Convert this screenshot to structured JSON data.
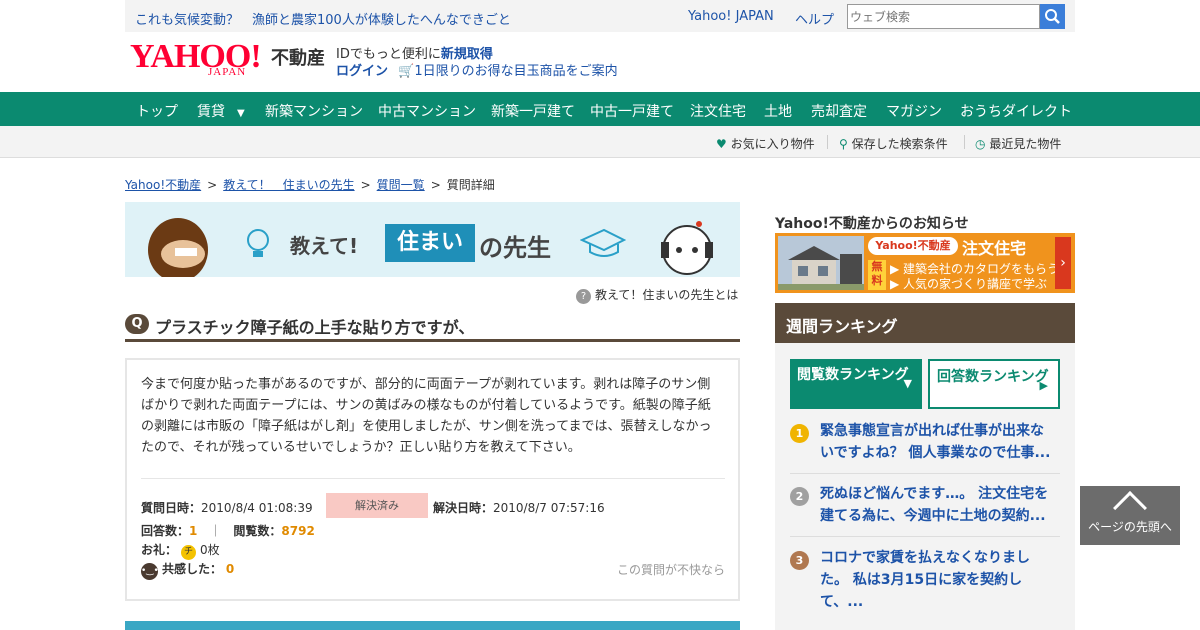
{
  "topbar": {
    "link1": "これも気候変動？",
    "link2": "漁師と農家100人が体験したへんなできごと",
    "yahoo_japan": "Yahoo! JAPAN",
    "help": "ヘルプ",
    "search_placeholder": "ウェブ検索"
  },
  "header": {
    "logo_text": "YAHOO!",
    "logo_sub": "JAPAN",
    "service": "不動産",
    "id_line": "IDでもっと便利に",
    "id_link": "新規取得",
    "login": "ログイン",
    "promo": "1日限りのお得な目玉商品をご案内"
  },
  "gnav": [
    "トップ",
    "賃貸",
    "新築マンション",
    "中古マンション",
    "新築一戸建て",
    "中古一戸建て",
    "注文住宅",
    "土地",
    "売却査定",
    "マガジン",
    "おうちダイレクト"
  ],
  "subnav": {
    "fav": "お気に入り物件",
    "saved": "保存した検索条件",
    "recent": "最近見た物件"
  },
  "breadcrumb": [
    "Yahoo!不動産",
    "教えて！　住まいの先生",
    "質問一覧",
    "質問詳細"
  ],
  "banner": {
    "t1": "教えて!",
    "house": "住まい",
    "t2": "の先生"
  },
  "about": "教えて！住まいの先生とは",
  "question": {
    "badge": "Q",
    "title": "プラスチック障子紙の上手な貼り方ですが、",
    "body": "今まで何度か貼った事があるのですが、部分的に両面テープが剥れています。剥れは障子のサン側ばかりで剥れた両面テープには、サンの黄ばみの様なものが付着しているようです。紙製の障子紙の剥離には市販の「障子紙はがし剤」を使用しましたが、サン側を洗ってまでは、張替えしなかったので、それが残っているせいでしょうか？正しい貼り方を教えて下さい。",
    "asked_label": "質問日時：",
    "asked": "2010/8/4 01:08:39",
    "status": "解決済み",
    "solved_label": "解決日時：",
    "solved": "2010/8/7 07:57:16",
    "answers_label": "回答数：",
    "answers": "1",
    "views_label": "閲覧数：",
    "views": "8792",
    "reward_label": "お礼：",
    "reward_chip": "チ",
    "reward": "0枚",
    "empathy_label": "共感した：",
    "empathy": "0",
    "report": "この質問が不快なら"
  },
  "sidebar": {
    "news_title": "Yahoo!不動産からのお知らせ",
    "news_pill": "Yahoo!不動産",
    "news_head": "注文住宅",
    "news_free": "無料",
    "news_l1": "建築会社のカタログをもらう",
    "news_l2": "人気の家づくり講座で学ぶ",
    "ranking_title": "週間ランキング",
    "tab1": "閲覧数ランキング",
    "tab2": "回答数ランキング",
    "ranks": [
      {
        "num": "1",
        "color": "#f0b400",
        "text": "緊急事態宣言が出れば仕事が出来ないですよね？ 個人事業なので仕事..."
      },
      {
        "num": "2",
        "color": "#a0a0a0",
        "text": "死ぬほど悩んでます…。 注文住宅を建てる為に、今週中に土地の契約..."
      },
      {
        "num": "3",
        "color": "#b07850",
        "text": "コロナで家賃を払えなくなりました。 私は3月15日に家を契約して、..."
      }
    ]
  },
  "totop": "ページの先頭へ"
}
